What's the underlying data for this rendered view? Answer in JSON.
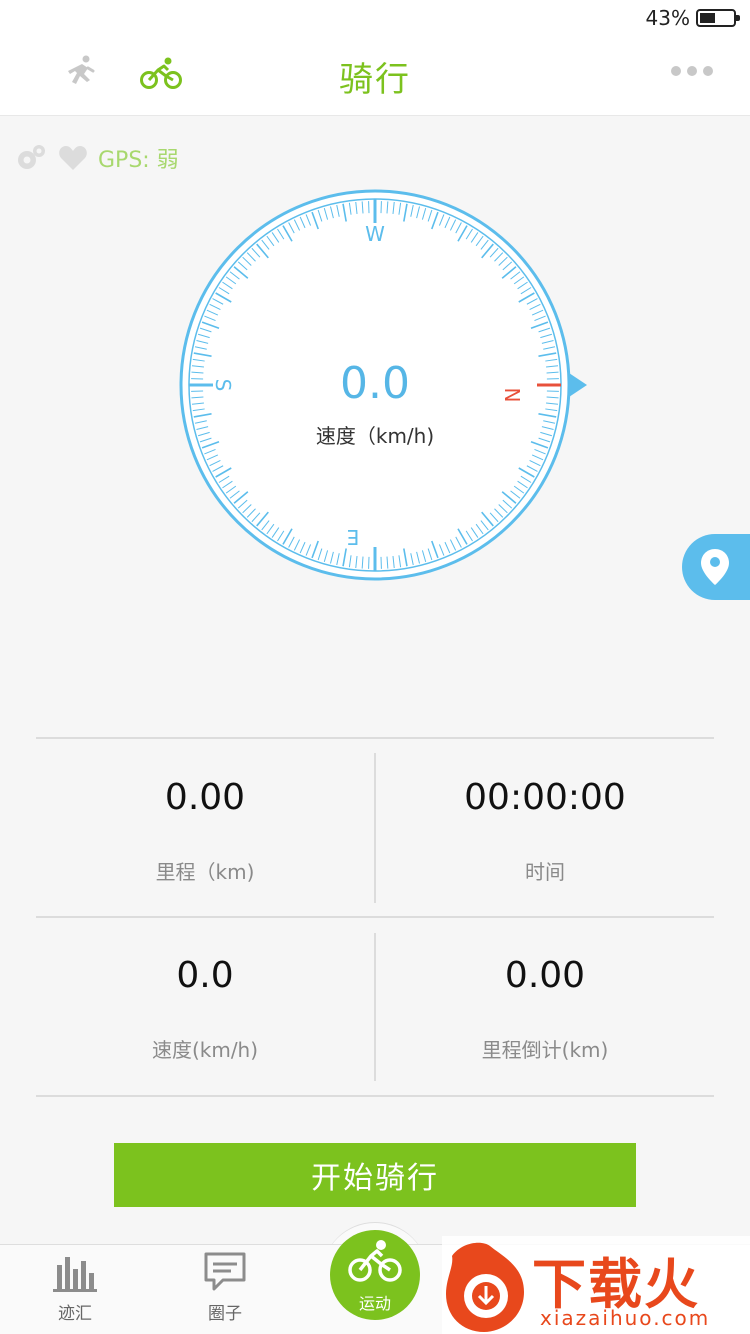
{
  "status": {
    "battery": "43%",
    "battery_level": 0.43
  },
  "header": {
    "title": "骑行",
    "active_mode": "bike-icon"
  },
  "gps": {
    "label": "GPS: 弱"
  },
  "compass": {
    "speed": "0.0",
    "speed_label": "速度（km/h)",
    "directions": {
      "top": "W",
      "left": "S",
      "right": "N",
      "bottom": "E"
    },
    "ring_color": "#5cbdec",
    "north_color": "#e8503a"
  },
  "stats": [
    {
      "value": "0.00",
      "label": "里程（km)"
    },
    {
      "value": "00:00:00",
      "label": "时间"
    },
    {
      "value": "0.0",
      "label": "速度(km/h)"
    },
    {
      "value": "0.00",
      "label": "里程倒计(km)"
    }
  ],
  "start_button": {
    "label": "开始骑行"
  },
  "tabs": [
    {
      "label": "迹汇",
      "icon": "bar-chart-icon"
    },
    {
      "label": "圈子",
      "icon": "chat-icon"
    },
    {
      "label": "运动",
      "icon": "bike-icon"
    }
  ],
  "watermark": {
    "title": "下载火",
    "subtitle": "xiazaihuo.com"
  },
  "colors": {
    "accent": "#7cc21e",
    "blue": "#5cbdec"
  }
}
